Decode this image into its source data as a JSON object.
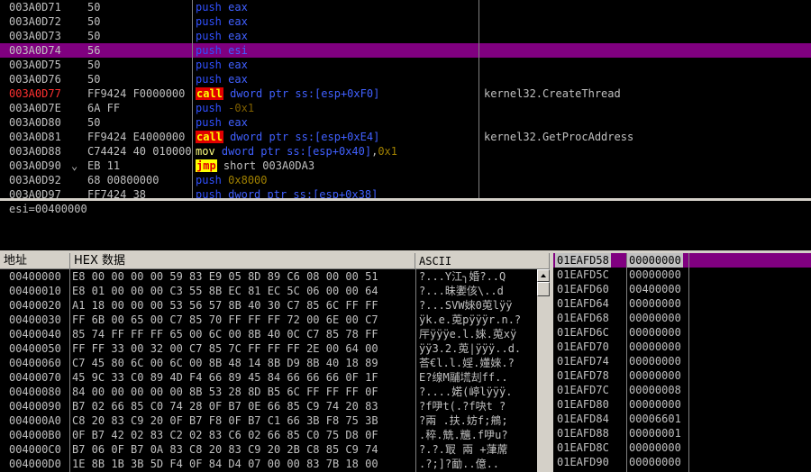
{
  "colors": {
    "selection": "#800080",
    "call_bg": "#e00000",
    "jmp_bg": "#ffff00",
    "push": "#3050ff"
  },
  "disasm": [
    {
      "addr": "003A0D71",
      "hex": "50",
      "mn": "push",
      "ops": [
        {
          "t": "eax",
          "c": "op"
        }
      ],
      "comment": ""
    },
    {
      "addr": "003A0D72",
      "hex": "50",
      "mn": "push",
      "ops": [
        {
          "t": "eax",
          "c": "op"
        }
      ],
      "comment": ""
    },
    {
      "addr": "003A0D73",
      "hex": "50",
      "mn": "push",
      "ops": [
        {
          "t": "eax",
          "c": "op"
        }
      ],
      "comment": ""
    },
    {
      "addr": "003A0D74",
      "hex": "56",
      "mn": "push",
      "ops": [
        {
          "t": "esi",
          "c": "op"
        }
      ],
      "comment": "",
      "selected": true
    },
    {
      "addr": "003A0D75",
      "hex": "50",
      "mn": "push",
      "ops": [
        {
          "t": "eax",
          "c": "op"
        }
      ],
      "comment": ""
    },
    {
      "addr": "003A0D76",
      "hex": "50",
      "mn": "push",
      "ops": [
        {
          "t": "eax",
          "c": "op"
        }
      ],
      "comment": ""
    },
    {
      "addr": "003A0D77",
      "hex": "FF9424 F0000000",
      "mn": "call",
      "ops": [
        {
          "t": "dword ptr ss:[esp+0xF0]",
          "c": "op"
        }
      ],
      "comment": "kernel32.CreateThread",
      "addr_highlight": true
    },
    {
      "addr": "003A0D7E",
      "hex": "6A FF",
      "mn": "push",
      "ops": [
        {
          "t": "-0x1",
          "c": "neg"
        }
      ],
      "comment": ""
    },
    {
      "addr": "003A0D80",
      "hex": "50",
      "mn": "push",
      "ops": [
        {
          "t": "eax",
          "c": "op"
        }
      ],
      "comment": ""
    },
    {
      "addr": "003A0D81",
      "hex": "FF9424 E4000000",
      "mn": "call",
      "ops": [
        {
          "t": "dword ptr ss:[esp+0xE4]",
          "c": "op"
        }
      ],
      "comment": "kernel32.GetProcAddress"
    },
    {
      "addr": "003A0D88",
      "hex": "C74424 40 01000000",
      "mn": "mov",
      "ops": [
        {
          "t": "dword ptr ss:[esp+0x40]",
          "c": "op"
        },
        {
          "t": ",",
          "c": "op-w"
        },
        {
          "t": "0x1",
          "c": "imm"
        }
      ],
      "comment": ""
    },
    {
      "addr": "003A0D90",
      "jump": "⌄",
      "hex": "EB 11",
      "mn": "jmp",
      "ops": [
        {
          "t": "short 003A0DA3",
          "c": "op-w"
        }
      ],
      "comment": ""
    },
    {
      "addr": "003A0D92",
      "hex": "68 00800000",
      "mn": "push",
      "ops": [
        {
          "t": "0x8000",
          "c": "imm"
        }
      ],
      "comment": ""
    },
    {
      "addr": "003A0D97",
      "hex": "FF7424 38",
      "mn": "push",
      "ops": [
        {
          "t": "dword ptr ss:[esp+0x38]",
          "c": "op"
        }
      ],
      "comment": ""
    }
  ],
  "info": {
    "text": "esi=00400000"
  },
  "dump": {
    "headers": {
      "address": "地址",
      "hex": "HEX 数据",
      "ascii": "ASCII"
    },
    "rows": [
      {
        "addr": "00400000",
        "hex": "E8 00 00 00 00 59 83 E9 05 8D 89 C6 08 00 00 51",
        "ascii": "?...Y江╮婚?..Q"
      },
      {
        "addr": "00400010",
        "hex": "E8 01 00 00 00 C3 55 8B EC 81 EC 5C 06 00 00 64",
        "ascii": "?...昧嬱侅\\..d"
      },
      {
        "addr": "00400020",
        "hex": "A1 18 00 00 00 53 56 57 8B 40 30 C7 85 6C FF FF",
        "ascii": "?...SVW婡0莵lÿÿ"
      },
      {
        "addr": "00400030",
        "hex": "FF 6B 00 65 00 C7 85 70 FF FF FF 72 00 6E 00 C7",
        "ascii": "ÿk.e.莵pÿÿÿr.n.?"
      },
      {
        "addr": "00400040",
        "hex": "85 74 FF FF FF 65 00 6C 00 8B 40 0C C7 85 78 FF",
        "ascii": "厈ÿÿÿe.l.婡.莵xÿ"
      },
      {
        "addr": "00400050",
        "hex": "FF FF 33 00 32 00 C7 85 7C FF FF FF 2E 00 64 00",
        "ascii": "ÿÿ3.2.莵|ÿÿÿ..d."
      },
      {
        "addr": "00400060",
        "hex": "C7 45 80 6C 00 6C 00 8B 48 14 8B D9 8B 40 18 89",
        "ascii": "荅€l.l.婬.嬞婡.?"
      },
      {
        "addr": "00400070",
        "hex": "45 9C 33 C0 89 4D F4 66 89 45 84 66 66 66 0F 1F",
        "ascii": "E?缐M鬴塃刦ff.."
      },
      {
        "addr": "00400080",
        "hex": "84 00 00 00 00 00 8B 53 28 8D B5 6C FF FF FF 0F",
        "ascii": "?....婼(嵉lÿÿÿ."
      },
      {
        "addr": "00400090",
        "hex": "B7 02 66 85 C0 74 28 0F B7 0E 66 85 C9 74 20 83",
        "ascii": "?f吚t(.?f吷t ?"
      },
      {
        "addr": "004000A0",
        "hex": "C8 20 83 C9 20 0F B7 F8 0F B7 C1 66 3B F8 75 3B",
        "ascii": "?兩 .扶.妨f;鴘;"
      },
      {
        "addr": "004000B0",
        "hex": "0F B7 42 02 83 C2 02 83 C6 02 66 85 C0 75 D8 0F",
        "ascii": ".稡.兟.兤.f吚u?"
      },
      {
        "addr": "004000C0",
        "hex": "B7 06 0F B7 0A 83 C8 20 83 C9 20 2B C8 85 C9 74",
        "ascii": "?.?.冣 兩 +葏蓆"
      },
      {
        "addr": "004000D0",
        "hex": "1E 8B 1B 3B 5D F4 0F 84 D4 07 00 00 83 7B 18 00",
        "ascii": ".?;]?勔..億.."
      }
    ]
  },
  "stack": [
    {
      "addr": "01EAFD58",
      "val": "00000000",
      "selected": true
    },
    {
      "addr": "01EAFD5C",
      "val": "00000000"
    },
    {
      "addr": "01EAFD60",
      "val": "00400000"
    },
    {
      "addr": "01EAFD64",
      "val": "00000000"
    },
    {
      "addr": "01EAFD68",
      "val": "00000000"
    },
    {
      "addr": "01EAFD6C",
      "val": "00000000"
    },
    {
      "addr": "01EAFD70",
      "val": "00000000"
    },
    {
      "addr": "01EAFD74",
      "val": "00000000"
    },
    {
      "addr": "01EAFD78",
      "val": "00000000"
    },
    {
      "addr": "01EAFD7C",
      "val": "00000008"
    },
    {
      "addr": "01EAFD80",
      "val": "00000000"
    },
    {
      "addr": "01EAFD84",
      "val": "00006601"
    },
    {
      "addr": "01EAFD88",
      "val": "00000001"
    },
    {
      "addr": "01EAFD8C",
      "val": "00000000"
    },
    {
      "addr": "01EAFD90",
      "val": "00000000"
    }
  ]
}
